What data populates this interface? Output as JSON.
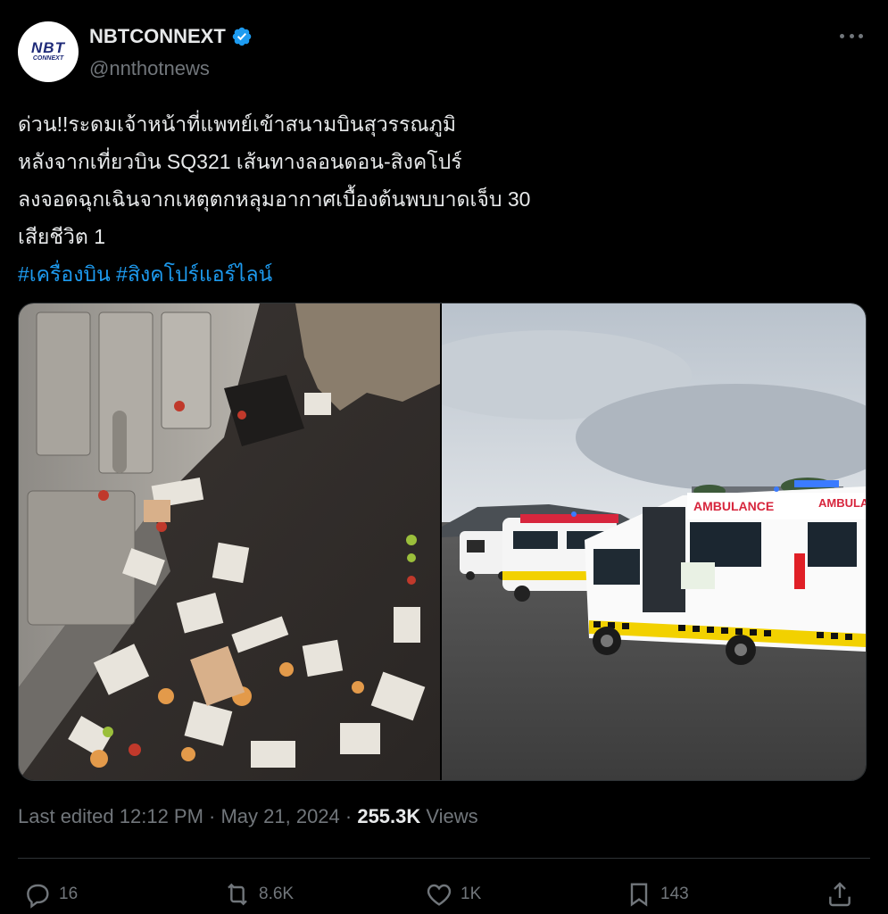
{
  "author": {
    "avatar_logo": "NBT",
    "avatar_logo_sub": "CONNEXT",
    "display_name": "NBTCONNEXT",
    "verified_icon": "verified-badge-icon",
    "handle": "@nnthotnews"
  },
  "tweet": {
    "lines": [
      "ด่วน!!ระดมเจ้าหน้าที่แพทย์เข้าสนามบินสุวรรณภูมิ",
      "หลังจากเที่ยวบิน SQ321 เส้นทางลอนดอน-สิงคโปร์",
      "ลงจอดฉุกเฉินจากเหตุตกหลุมอากาศเบื้องต้นพบบาดเจ็บ 30",
      "เสียชีวิต 1"
    ],
    "hashtags": [
      "#เครื่องบิน",
      "#สิงคโปร์แอร์ไลน์"
    ]
  },
  "media": {
    "left_photo": "aircraft-cabin-debris-photo",
    "right_photo": "ambulances-on-tarmac-photo",
    "ambulance_text": "AMBULANCE",
    "ambulance_side_text": "AMBULANCE"
  },
  "meta": {
    "edited": "Last edited 12:12 PM · May 21, 2024 · ",
    "views_count": "255.3K",
    "views_label": " Views"
  },
  "actions": {
    "replies": "16",
    "reposts": "8.6K",
    "likes": "1K",
    "bookmarks": "143"
  },
  "colors": {
    "background": "#000000",
    "text": "#e7e9ea",
    "muted": "#71767b",
    "link": "#1d9bf0",
    "verified": "#1d9bf0"
  }
}
